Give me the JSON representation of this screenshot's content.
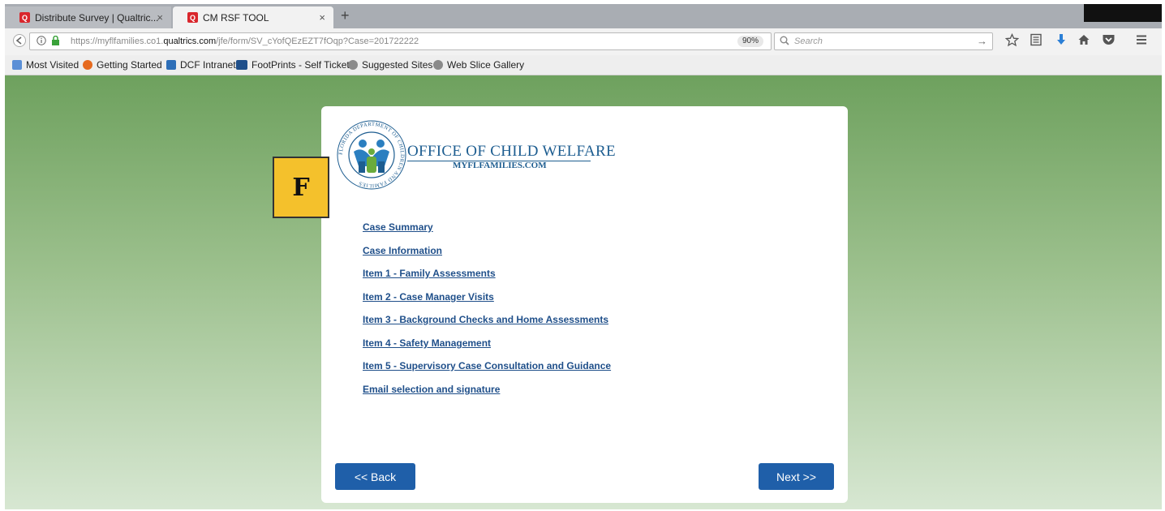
{
  "browser": {
    "tabs": [
      {
        "title": "Distribute Survey | Qualtric...",
        "close": "×",
        "favicon": "Q"
      },
      {
        "title": "CM RSF TOOL",
        "close": "×",
        "favicon": "Q"
      }
    ],
    "new_tab": "+",
    "url": {
      "prefix": "https://myflfamilies.co1.",
      "domain": "qualtrics.com",
      "path": "/jfe/form/SV_cYofQEzEZT7fOqp?Case=201722222"
    },
    "zoom": "90%",
    "search_placeholder": "Search",
    "bookmarks": [
      "Most Visited",
      "Getting Started",
      "DCF Intranet",
      "FootPrints - Self Ticket",
      "Suggested Sites",
      "Web Slice Gallery"
    ]
  },
  "page": {
    "logo": {
      "seal_text": "FLORIDA DEPARTMENT OF CHILDREN AND FAMILIES",
      "title": "OFFICE OF CHILD WELFARE",
      "subtitle": "MYFLFAMILIES.COM"
    },
    "marker": "F",
    "links": [
      "Case Summary",
      "Case Information",
      "Item 1 - Family Assessments",
      "Item 2 - Case Manager Visits",
      "Item 3 - Background Checks and Home Assessments",
      "Item 4 - Safety Management",
      "Item 5 - Supervisory Case Consultation and Guidance",
      "Email selection and signature"
    ],
    "back_label": "<< Back",
    "next_label": "Next >>"
  },
  "colors": {
    "accent": "#1f5fa9",
    "link": "#1f4f8a",
    "marker": "#f4c12c",
    "background_top": "#6ea15e"
  }
}
